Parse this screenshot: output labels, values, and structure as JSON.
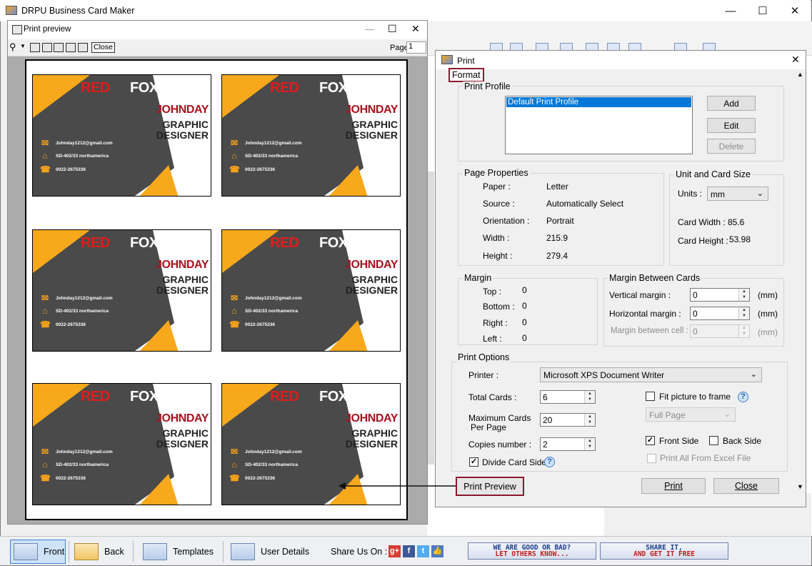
{
  "app": {
    "title": "DRPU Business Card Maker"
  },
  "print_preview": {
    "title": "Print preview",
    "close_label": "Close",
    "page_label": "Page",
    "page_value": "1"
  },
  "card": {
    "brand_red": "RED",
    "brand_fox": "FOX",
    "name": "JOHNDAY",
    "title_line1": "GRAPHIC",
    "title_line2": "DESIGNER",
    "email": "Johnday1212@gmail.com",
    "address": "SD-402/33 northamerica",
    "phone": "0022-2675336",
    "colors": {
      "orange": "#f7a81b",
      "dark": "#4a4a4a",
      "red": "#e11c1c",
      "name": "#a4141e"
    }
  },
  "dialog": {
    "title": "Print",
    "tab": "Format",
    "print_profile": {
      "label": "Print Profile",
      "items": [
        "Default Print Profile"
      ],
      "add": "Add",
      "edit": "Edit",
      "delete": "Delete"
    },
    "page_properties": {
      "label": "Page Properties",
      "rows": [
        {
          "k": "Paper :",
          "v": "Letter"
        },
        {
          "k": "Source :",
          "v": "Automatically Select"
        },
        {
          "k": "Orientation :",
          "v": "Portrait"
        },
        {
          "k": "Width :",
          "v": "215.9"
        },
        {
          "k": "Height :",
          "v": "279.4"
        }
      ]
    },
    "unit_card_size": {
      "label": "Unit and Card Size",
      "units_label": "Units :",
      "units_value": "mm",
      "card_width_label": "Card Width :",
      "card_width": "85.6",
      "card_height_label": "Card Height :",
      "card_height": "53.98"
    },
    "margin": {
      "label": "Margin",
      "rows": [
        {
          "k": "Top :",
          "v": "0"
        },
        {
          "k": "Bottom :",
          "v": "0"
        },
        {
          "k": "Right :",
          "v": "0"
        },
        {
          "k": "Left :",
          "v": "0"
        }
      ]
    },
    "margin_between": {
      "label": "Margin Between Cards",
      "vertical_label": "Vertical margin :",
      "vertical_value": "0",
      "horizontal_label": "Horizontal margin :",
      "horizontal_value": "0",
      "cell_label": "Margin between cell :",
      "cell_value": "0",
      "unit": "(mm)"
    },
    "print_options": {
      "label": "Print Options",
      "printer_label": "Printer :",
      "printer_value": "Microsoft XPS Document Writer",
      "total_cards_label": "Total Cards :",
      "total_cards": "6",
      "max_cards_label1": "Maximum Cards",
      "max_cards_label2": "Per Page",
      "max_cards": "20",
      "copies_label": "Copies number :",
      "copies": "2",
      "divide_label": "Divide Card Side",
      "divide_checked": true,
      "fit_label": "Fit picture to frame",
      "fit_checked": false,
      "fit_mode": "Full Page",
      "front_label": "Front Side",
      "front_checked": true,
      "back_label": "Back Side",
      "back_checked": false,
      "excel_label": "Print All From Excel File",
      "excel_checked": false
    },
    "buttons": {
      "preview": "Print Preview",
      "print": "Print",
      "close": "Close"
    }
  },
  "bottom_bar": {
    "front": "Front",
    "back": "Back",
    "templates": "Templates",
    "user_details": "User Details",
    "share_label": "Share Us On :",
    "banner1_line1": "WE ARE GOOD OR BAD?",
    "banner1_line2": "LET OTHERS KNOW...",
    "banner2_line1": "SHARE IT,",
    "banner2_line2": "AND GET IT FREE"
  }
}
